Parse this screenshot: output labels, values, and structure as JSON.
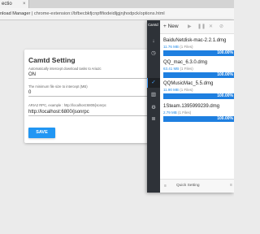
{
  "browser": {
    "tab_title": "ectio",
    "tab_close": "×",
    "url_prefix": "nload Manager",
    "url_separator": " | ",
    "url": "chrome-extension://bfbecbkfjcnpflfiodeidljgjnjhodpck/options.html"
  },
  "settings": {
    "title": "Camtd Setting",
    "auto_intercept_label": "Automatically intercept download tasks to Aria2c",
    "auto_intercept_value": "ON",
    "min_size_label": "The minimum file size to intercept (MB)",
    "min_size_value": "0",
    "rpc_label": "ARIA2 RPC, example : http://localhost:6800/jsonrpc",
    "rpc_value": "http://localhost:6800/jsonrpc",
    "save_label": "SAVE"
  },
  "popup": {
    "brand": "Camtd",
    "new_label": "+ New",
    "sidebar_icons": [
      "download-icon",
      "clock-icon",
      "check-circle-icon",
      "trash-icon",
      "settings-icon",
      "list-icon"
    ],
    "tasks": [
      {
        "name": "BaiduNetdisk-mac-2.2.1.dmg",
        "size": "11.76 MB",
        "files": "(1 Files)",
        "progress": 1.0,
        "progress_label": "100.00%"
      },
      {
        "name": "QQ_mac_6.3.0.dmg",
        "size": "63.41 MB",
        "files": "(1 Files)",
        "progress": 1.0,
        "progress_label": "100.00%"
      },
      {
        "name": "QQMusicMac_5.5.dmg",
        "size": "11.90 MB",
        "files": "(1 Files)",
        "progress": 1.0,
        "progress_label": "100.00%"
      },
      {
        "name": "1Steam.1395999239.dmg",
        "size": "2.79 MB",
        "files": "(1 Files)",
        "progress": 1.0,
        "progress_label": "100.00%"
      }
    ],
    "footer_icon": "≡",
    "quick_setting": "Quick Setting",
    "footer_menu": "≡"
  },
  "colors": {
    "accent": "#2196f3",
    "progress": "#1e7fe0",
    "sidebar": "#2e3238"
  }
}
